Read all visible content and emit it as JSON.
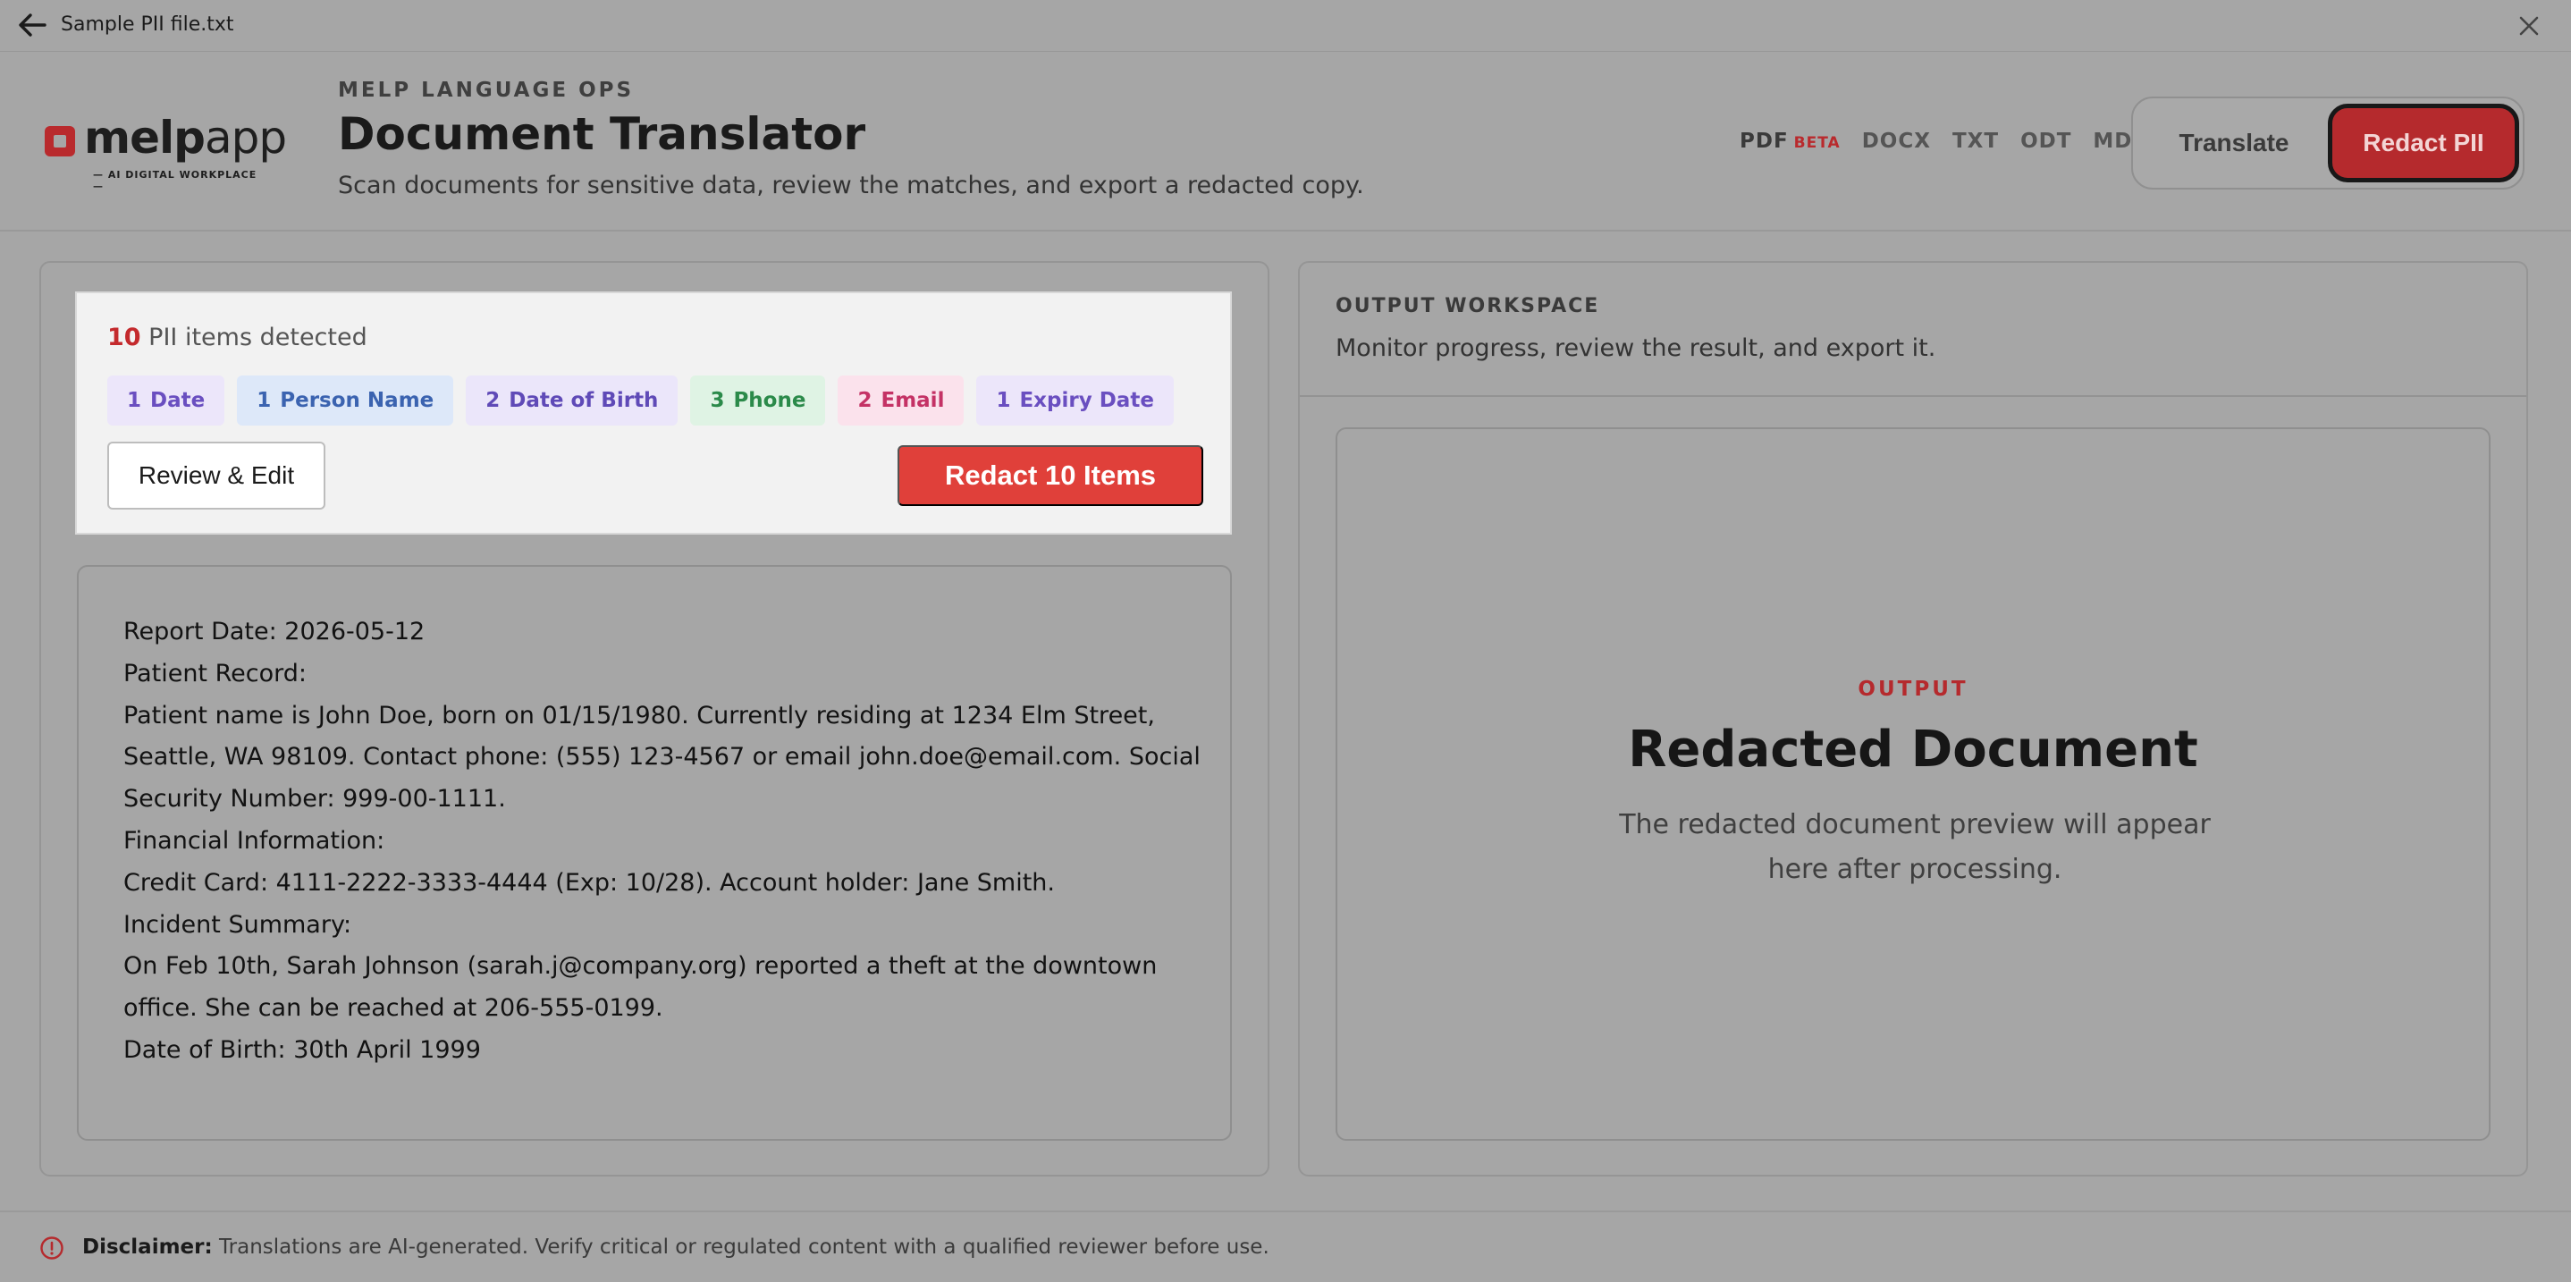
{
  "titlebar": {
    "file_name": "Sample PII file.txt",
    "back_icon": "arrow-left-icon",
    "close_icon": "close-icon"
  },
  "header": {
    "logo_text_bold": "melp",
    "logo_text_light": "app",
    "logo_tagline": "— AI DIGITAL WORKPLACE —",
    "eyebrow": "MELP LANGUAGE OPS",
    "title": "Document Translator",
    "subtitle": "Scan documents for sensitive data, review the matches, and export a redacted copy.",
    "formats": [
      {
        "label": "PDF",
        "badge": "BETA"
      },
      {
        "label": "DOCX"
      },
      {
        "label": "TXT"
      },
      {
        "label": "ODT"
      },
      {
        "label": "MD"
      }
    ],
    "mode_translate": "Translate",
    "mode_redact": "Redact PII",
    "accent_color": "#b52a2d"
  },
  "pii_summary": {
    "count": "10",
    "count_label": "PII items detected",
    "chips": [
      {
        "n": "1",
        "label": "Date"
      },
      {
        "n": "1",
        "label": "Person Name"
      },
      {
        "n": "2",
        "label": "Date of Birth"
      },
      {
        "n": "3",
        "label": "Phone"
      },
      {
        "n": "2",
        "label": "Email"
      },
      {
        "n": "1",
        "label": "Expiry Date"
      }
    ],
    "review_button": "Review & Edit",
    "redact_button": "Redact 10 Items"
  },
  "document": {
    "lines": [
      "Report Date: 2026-05-12",
      "Patient Record:",
      "Patient name is John Doe, born on 01/15/1980. Currently residing at 1234 Elm Street, Seattle, WA 98109. Contact phone: (555) 123-4567 or email john.doe@email.com. Social Security Number: 999-00-1111.",
      "Financial Information:",
      "Credit Card: 4111-2222-3333-4444 (Exp: 10/28). Account holder: Jane Smith.",
      "Incident Summary:",
      "On Feb 10th, Sarah Johnson (sarah.j@company.org) reported a theft at the downtown office. She can be reached at 206-555-0199.",
      "Date of Birth: 30th April 1999"
    ]
  },
  "output": {
    "eyebrow": "OUTPUT WORKSPACE",
    "subtitle": "Monitor progress, review the result, and export it.",
    "preview_label": "OUTPUT",
    "preview_title": "Redacted Document",
    "preview_text": "The redacted document preview will appear here after processing."
  },
  "footer": {
    "disclaimer_label": "Disclaimer:",
    "disclaimer_text": " Translations are AI-generated. Verify critical or regulated content with a qualified reviewer before use.",
    "icon": "info-circle-icon"
  }
}
